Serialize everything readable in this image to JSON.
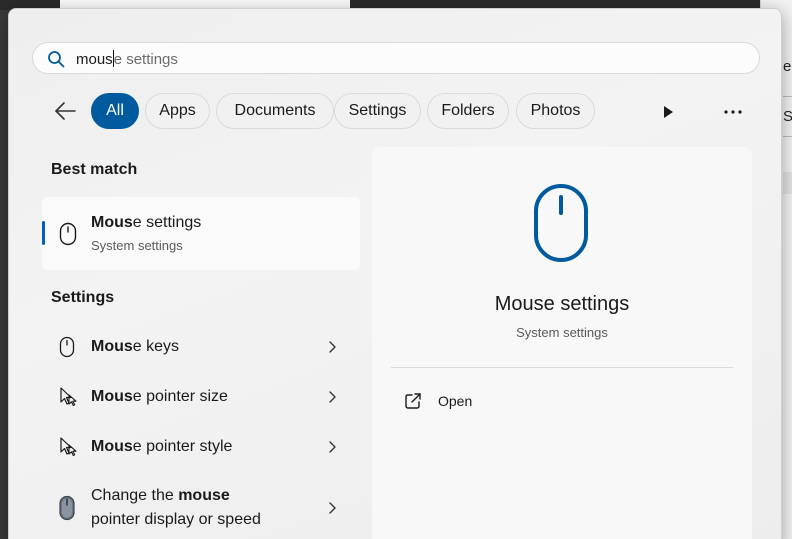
{
  "search": {
    "typed": "mous",
    "completion": "e settings"
  },
  "filters": [
    "All",
    "Apps",
    "Documents",
    "Settings",
    "Folders",
    "Photos"
  ],
  "best_match": {
    "heading": "Best match",
    "title_bold": "Mous",
    "title_rest": "e settings",
    "subtitle": "System settings"
  },
  "settings": {
    "heading": "Settings",
    "items": [
      {
        "bold": "Mous",
        "rest": "e keys"
      },
      {
        "bold": "Mous",
        "rest": "e pointer size"
      },
      {
        "bold": "Mous",
        "rest": "e pointer style"
      },
      {
        "line1_pre": "Change the ",
        "line1_bold": "mouse",
        "line2": "pointer display or speed"
      }
    ]
  },
  "preview": {
    "title": "Mouse settings",
    "subtitle": "System settings",
    "open_label": "Open"
  },
  "background": {
    "fragment1": "e-",
    "fragment2": "S"
  },
  "colors": {
    "accent": "#005a9e",
    "icon_blue": "#005a9e"
  }
}
